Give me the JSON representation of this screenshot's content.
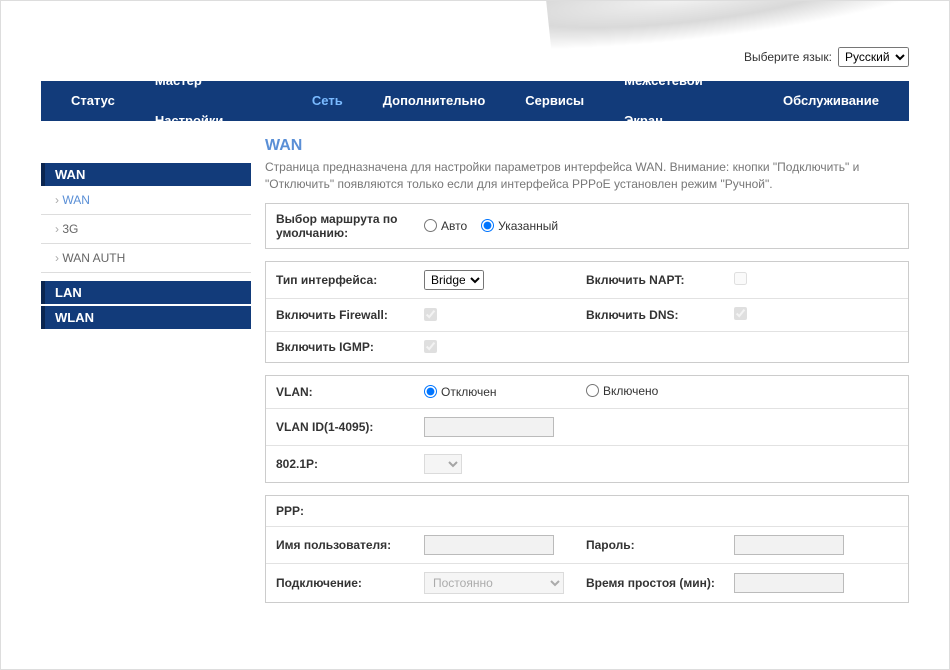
{
  "lang": {
    "label": "Выберите язык:",
    "selected": "Русский"
  },
  "nav": {
    "status": "Статус",
    "wizard": "Мастер Настройки",
    "network": "Сеть",
    "advanced": "Дополнительно",
    "services": "Сервисы",
    "firewall": "Межсетевой Экран",
    "maintenance": "Обслуживание"
  },
  "sidebar": {
    "wan_header": "WAN",
    "items": {
      "wan": "WAN",
      "g3": "3G",
      "wan_auth": "WAN AUTH"
    },
    "lan_header": "LAN",
    "wlan_header": "WLAN"
  },
  "page": {
    "title": "WAN",
    "desc": "Страница предназначена для настройки параметров интерфейса WAN. Внимание: кнопки \"Подключить\" и \"Отключить\" появляются только если для интерфейса PPPoE установлен режим \"Ручной\"."
  },
  "labels": {
    "default_route": "Выбор маршрута по умолчанию:",
    "auto": "Авто",
    "specified": "Указанный",
    "interface_type": "Тип интерфейса:",
    "bridge": "Bridge",
    "enable_napt": "Включить NAPT:",
    "enable_firewall": "Включить Firewall:",
    "enable_dns": "Включить DNS:",
    "enable_igmp": "Включить IGMP:",
    "vlan": "VLAN:",
    "disabled": "Отключен",
    "enabled": "Включено",
    "vlan_id": "VLAN ID(1-4095):",
    "dot1p": "802.1P:",
    "ppp": "PPP:",
    "username": "Имя пользователя:",
    "password": "Пароль:",
    "connection": "Подключение:",
    "constant": "Постоянно",
    "idle_time": "Время простоя (мин):"
  }
}
